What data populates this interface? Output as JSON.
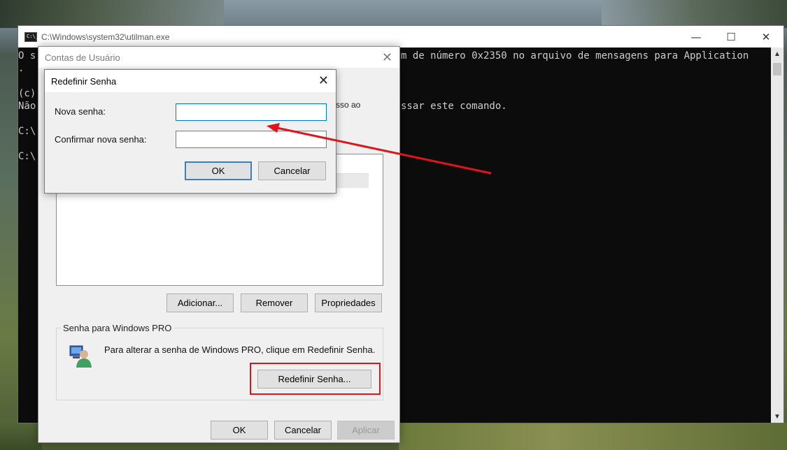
{
  "console": {
    "title": "C:\\Windows\\system32\\utilman.exe",
    "controls": {
      "minimize": "—",
      "maximize": "☐",
      "close": "✕"
    },
    "lines": [
      "O s",
      ".",
      "(c)",
      "Não",
      "C:\\",
      "C:\\"
    ],
    "right_lines": [
      "m de número 0x2350 no arquivo de mensagens para Application",
      "ssar este comando."
    ]
  },
  "accounts_dialog": {
    "title": "Contas de Usuário",
    "partial_text": "sso ao",
    "buttons": {
      "add": "Adicionar...",
      "remove": "Remover",
      "properties": "Propriedades"
    },
    "group": {
      "label": "Senha para Windows PRO",
      "text": "Para alterar a senha de Windows PRO, clique em Redefinir Senha.",
      "reset_button": "Redefinir Senha..."
    },
    "footer": {
      "ok": "OK",
      "cancel": "Cancelar",
      "apply": "Aplicar"
    }
  },
  "reset_dialog": {
    "title": "Redefinir Senha",
    "new_password_label": "Nova senha:",
    "new_password_value": "",
    "confirm_label": "Confirmar nova senha:",
    "confirm_value": "",
    "ok": "OK",
    "cancel": "Cancelar"
  },
  "annotation_color": "#e0141b"
}
